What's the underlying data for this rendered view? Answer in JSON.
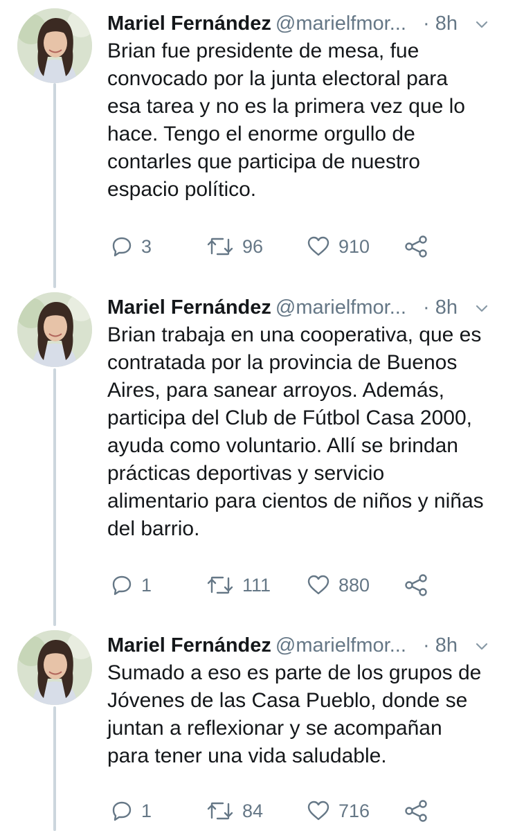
{
  "thread": {
    "tweets": [
      {
        "author_name": "Mariel Fernández",
        "handle": "@marielfmor...",
        "time": "· 8h",
        "text": "Brian fue presidente de mesa, fue\nconvocado por la junta electoral para\nesa tarea y no es la primera vez que lo\nhace. Tengo el enorme orgullo de\ncontarles que participa de nuestro\nespacio político.",
        "replies": "3",
        "retweets": "96",
        "likes": "910"
      },
      {
        "author_name": "Mariel Fernández",
        "handle": "@marielfmor...",
        "time": "· 8h",
        "text": "Brian trabaja en una cooperativa, que es\ncontratada por la provincia de Buenos\nAires, para sanear arroyos. Además,\nparticipa del Club de Fútbol Casa 2000,\nayuda como voluntario. Allí se brindan\nprácticas deportivas y servicio\nalimentario para cientos de niños y niñas\ndel barrio.",
        "replies": "1",
        "retweets": "111",
        "likes": "880"
      },
      {
        "author_name": "Mariel Fernández",
        "handle": "@marielfmor...",
        "time": "· 8h",
        "text": "Sumado a eso es parte de los grupos de\nJóvenes de las Casa Pueblo, donde se\njuntan a reflexionar y se acompañan\npara tener una vida saludable.",
        "replies": "1",
        "retweets": "84",
        "likes": "716"
      }
    ]
  },
  "icons": {
    "reply": "reply-icon",
    "retweet": "retweet-icon",
    "like": "heart-icon",
    "share": "share-icon",
    "menu": "chevron-down-icon"
  },
  "colors": {
    "text": "#14171a",
    "secondary": "#657786",
    "thread_line": "#ccd6dd"
  }
}
